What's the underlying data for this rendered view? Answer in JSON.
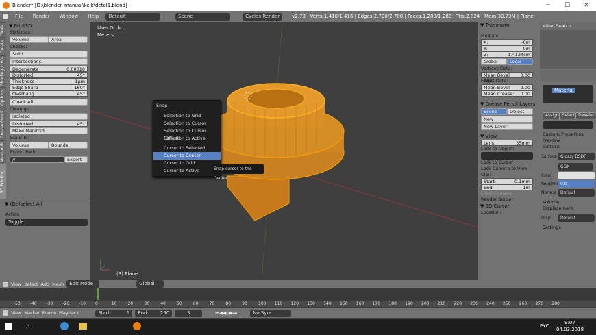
{
  "titlebar": {
    "title": "Blender* [D:\\blender_manual\\keik\\detal1.blend]",
    "minimize": "─",
    "maximize": "☐",
    "close": "✕"
  },
  "menubar": {
    "items": [
      "File",
      "Render",
      "Window",
      "Help"
    ],
    "layout": "Default",
    "scene": "Scene",
    "engine": "Cycles Render",
    "stats": "v2.79 | Verts:1,416/1,416 | Edges:2,700/2,700 | Faces:1,288/1,288 | Tris:2,824 | Mem:30.73M | Plane"
  },
  "toolshelf": {
    "tabs": [
      "Tools",
      "Create",
      "Shading / UVs",
      "Options",
      "Grease Pencil",
      "Measureit",
      "3D Printing"
    ],
    "title": "Print3D",
    "statistics": "Statistics:",
    "vol_btn": "Volume",
    "area_btn": "Area",
    "checks": "Checks:",
    "solid": "Solid",
    "intersections": "Intersections",
    "rows": [
      {
        "label": "Degenerate",
        "value": "0.00010"
      },
      {
        "label": "Distorted",
        "value": "45°"
      },
      {
        "label": "Thickness",
        "value": "1µm"
      },
      {
        "label": "Edge Sharp",
        "value": "160°"
      },
      {
        "label": "Overhang",
        "value": "45°"
      }
    ],
    "check_all": "Check All",
    "cleanup": "Cleanup:",
    "isolated": "Isolated",
    "distorted": "Distorted",
    "distorted_val": "45°",
    "make_manifold": "Make Manifold",
    "scale_to": "Scale To:",
    "bounds": "Bounds",
    "export_path": "Export Path:",
    "export_val": "//",
    "export_btn": "Export"
  },
  "operator": {
    "title": "(De)select All",
    "action_label": "Action",
    "action_value": "Toggle"
  },
  "viewport": {
    "view": "User Ortho",
    "units": "Meters",
    "object": "(3) Plane"
  },
  "snap_menu": {
    "title": "Snap",
    "items": [
      "Selection to Grid",
      "Selection to Cursor",
      "Selection to Cursor (Offset)",
      "Selection to Active",
      "Cursor to Selected",
      "Cursor to Center",
      "Cursor to Grid",
      "Cursor to Active"
    ],
    "highlighted": 5
  },
  "tooltip": "Snap cursor to the Center",
  "npanel": {
    "transform": "Transform",
    "median": "Median:",
    "x": "X:",
    "x_val": "-0m",
    "y": "Y:",
    "y_val": "-0m",
    "z": "Z:",
    "z_val": "1.4124cm",
    "global": "Global",
    "local": "Local",
    "vertices": "Vertices Data:",
    "mean_bevel": "Mean Bevel Wei:",
    "bevel_val": "0.00",
    "edges": "Edges Data:",
    "mean_bevel2": "Mean Bevel Wei:",
    "bevel_val2": "0.00",
    "mean_crease": "Mean Crease:",
    "crease_val": "0.00",
    "gp_layers": "Grease Pencil Layers",
    "scene_btn": "Scene",
    "object_btn": "Object",
    "new": "New",
    "new_layer": "New Layer",
    "view": "View",
    "lens": "Lens:",
    "lens_val": "35mm",
    "lock_obj": "Lock to Object:",
    "lock_cursor": "Lock to Cursor",
    "lock_camera": "Lock Camera to View",
    "clip": "Clip:",
    "start": "Start:",
    "start_val": "0.1mm",
    "end": "End:",
    "end_val": "1m",
    "local_camera": "Local Camera:",
    "render_border": "Render Border",
    "cursor3d": "3D Cursor",
    "location": "Location:"
  },
  "properties": {
    "view": "View",
    "search": "Search",
    "material": "Material",
    "assign": "Assign",
    "select": "Select",
    "deselect": "Deselect",
    "custom": "Custom Properties",
    "preview": "Preview",
    "surface": "Surface",
    "surf_lbl": "Surface",
    "surf_val": "Glossy BSDF",
    "ggx": "GGX",
    "color": "Color",
    "rough": "Roughness",
    "rough_val": "0.0",
    "normal": "Normal",
    "normal_val": "Default",
    "volume": "Volume",
    "displacement": "Displacement",
    "displ": "Displ",
    "displ_val": "Default",
    "settings": "Settings"
  },
  "viewheader": {
    "items": [
      "View",
      "Select",
      "Add",
      "Mesh"
    ],
    "mode": "Edit Mode",
    "pivot": "Global"
  },
  "timeline": {
    "ticks": [
      "-50",
      "-40",
      "-30",
      "-20",
      "-10",
      "0",
      "10",
      "20",
      "30",
      "40",
      "50",
      "60",
      "70",
      "80",
      "90",
      "100",
      "110",
      "120",
      "130",
      "140",
      "150",
      "160",
      "170",
      "180",
      "190",
      "200",
      "210",
      "220",
      "230",
      "240",
      "250",
      "260",
      "270",
      "280"
    ],
    "menu": [
      "View",
      "Marker",
      "Frame",
      "Playback"
    ],
    "start_lbl": "Start:",
    "start_val": "1",
    "end_lbl": "End:",
    "end_val": "250",
    "frame": "3",
    "sync": "No Sync"
  },
  "taskbar": {
    "lang": "РУС",
    "time": "9:07",
    "date": "04.03.2018"
  },
  "colors": {
    "accent": "#5680c2",
    "orange": "#f5a000",
    "mesh": "#e8901e"
  }
}
